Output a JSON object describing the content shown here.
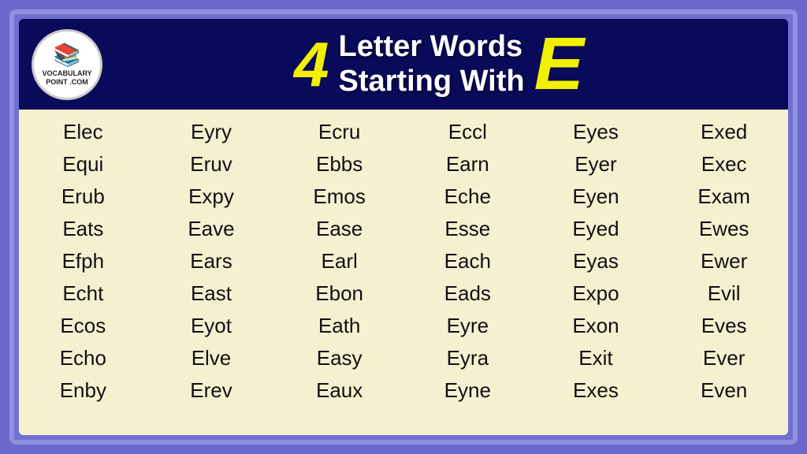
{
  "header": {
    "logo": {
      "icon": "📚",
      "line1": "VOCABULARY",
      "line2": "POINT",
      "line3": ".COM"
    },
    "number": "4",
    "title_line1": "Letter Words",
    "title_line2": "Starting With",
    "letter": "E"
  },
  "words": [
    [
      "Elec",
      "Eyry",
      "Ecru",
      "Eccl",
      "Eyes",
      "Exed"
    ],
    [
      "Equi",
      "Eruv",
      "Ebbs",
      "Earn",
      "Eyer",
      "Exec"
    ],
    [
      "Erub",
      "Expy",
      "Emos",
      "Eche",
      "Eyen",
      "Exam"
    ],
    [
      "Eats",
      "Eave",
      "Ease",
      "Esse",
      "Eyed",
      "Ewes"
    ],
    [
      "Efph",
      "Ears",
      "Earl",
      "Each",
      "Eyas",
      "Ewer"
    ],
    [
      "Echt",
      "East",
      "Ebon",
      "Eads",
      "Expo",
      "Evil"
    ],
    [
      "Ecos",
      "Eyot",
      "Eath",
      "Eyre",
      "Exon",
      "Eves"
    ],
    [
      "Echo",
      "Elve",
      "Easy",
      "Eyra",
      "Exit",
      "Ever"
    ],
    [
      "Enby",
      "Erev",
      "Eaux",
      "Eyne",
      "Exes",
      "Even"
    ]
  ]
}
